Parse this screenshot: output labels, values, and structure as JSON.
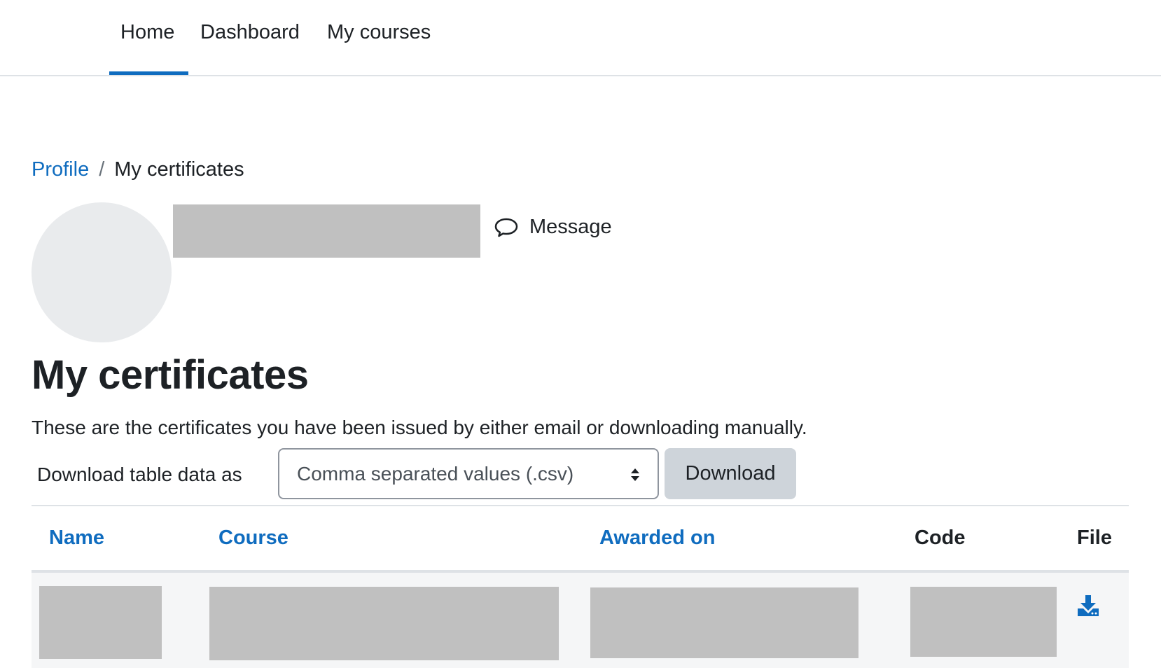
{
  "nav": {
    "items": [
      {
        "label": "Home",
        "active": true
      },
      {
        "label": "Dashboard"
      },
      {
        "label": "My courses"
      }
    ]
  },
  "breadcrumb": {
    "items": [
      "Profile",
      "My certificates"
    ],
    "separator": "/"
  },
  "profile": {
    "message_label": "Message"
  },
  "page": {
    "title": "My certificates",
    "intro": "These are the certificates you have been issued by either email or downloading manually."
  },
  "download": {
    "label": "Download table data as",
    "selected_format": "Comma separated values (.csv)",
    "button_label": "Download"
  },
  "table": {
    "columns": [
      "Name",
      "Course",
      "Awarded on",
      "Code",
      "File"
    ]
  },
  "colors": {
    "accent": "#0f6cbf",
    "redaction": "#c0c0c0"
  }
}
